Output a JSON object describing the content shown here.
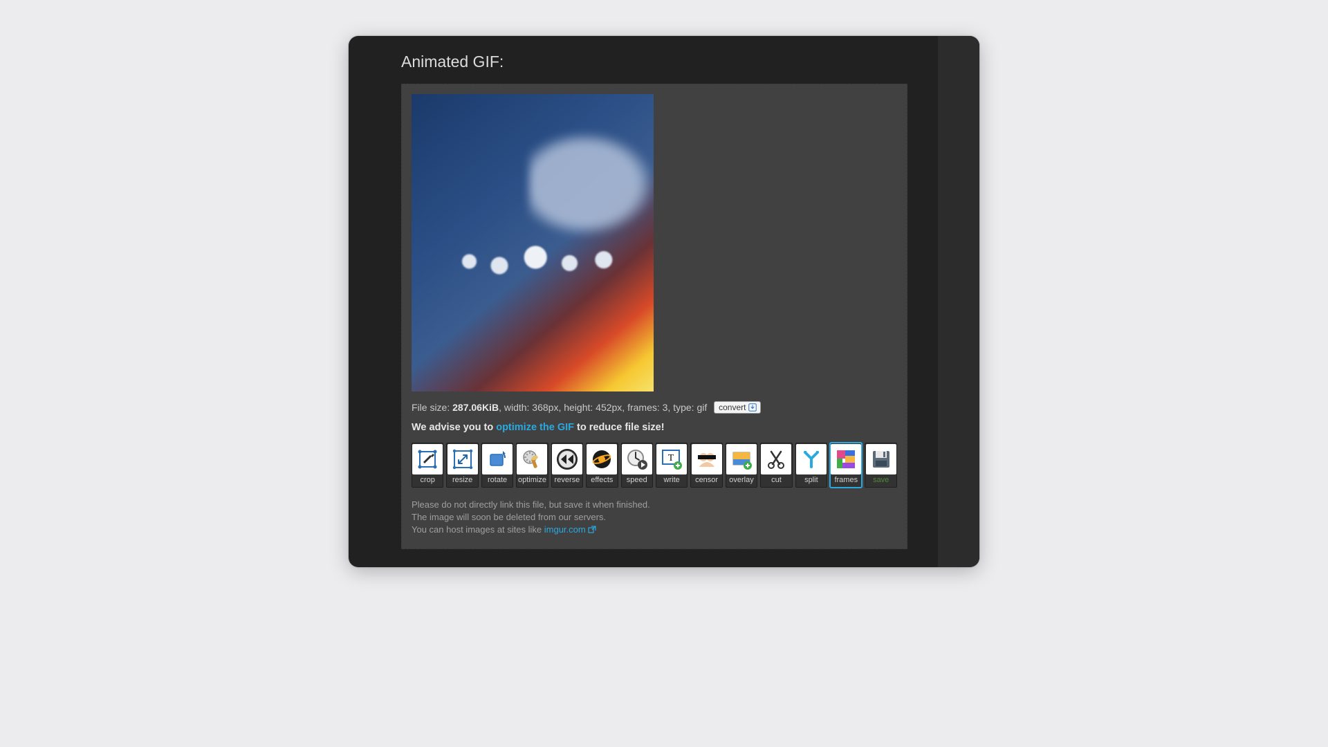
{
  "page_title": "Animated GIF:",
  "file": {
    "size_label": "File size: ",
    "size_value": "287.06KiB",
    "meta_tail": ", width: 368px, height: 452px, frames: 3, type: gif"
  },
  "convert_label": "convert",
  "advice": {
    "prefix": "We advise you to ",
    "link": "optimize the GIF",
    "suffix": " to reduce file size!"
  },
  "tools": [
    {
      "id": "crop",
      "label": "crop"
    },
    {
      "id": "resize",
      "label": "resize"
    },
    {
      "id": "rotate",
      "label": "rotate"
    },
    {
      "id": "optimize",
      "label": "optimize"
    },
    {
      "id": "reverse",
      "label": "reverse"
    },
    {
      "id": "effects",
      "label": "effects"
    },
    {
      "id": "speed",
      "label": "speed"
    },
    {
      "id": "write",
      "label": "write"
    },
    {
      "id": "censor",
      "label": "censor"
    },
    {
      "id": "overlay",
      "label": "overlay"
    },
    {
      "id": "cut",
      "label": "cut"
    },
    {
      "id": "split",
      "label": "split"
    },
    {
      "id": "frames",
      "label": "frames",
      "active": true
    },
    {
      "id": "save",
      "label": "save"
    }
  ],
  "notes": {
    "line1": "Please do not directly link this file, but save it when finished.",
    "line2": "The image will soon be deleted from our servers.",
    "line3_prefix": "You can host images at sites like ",
    "line3_link": "imgur.com"
  }
}
